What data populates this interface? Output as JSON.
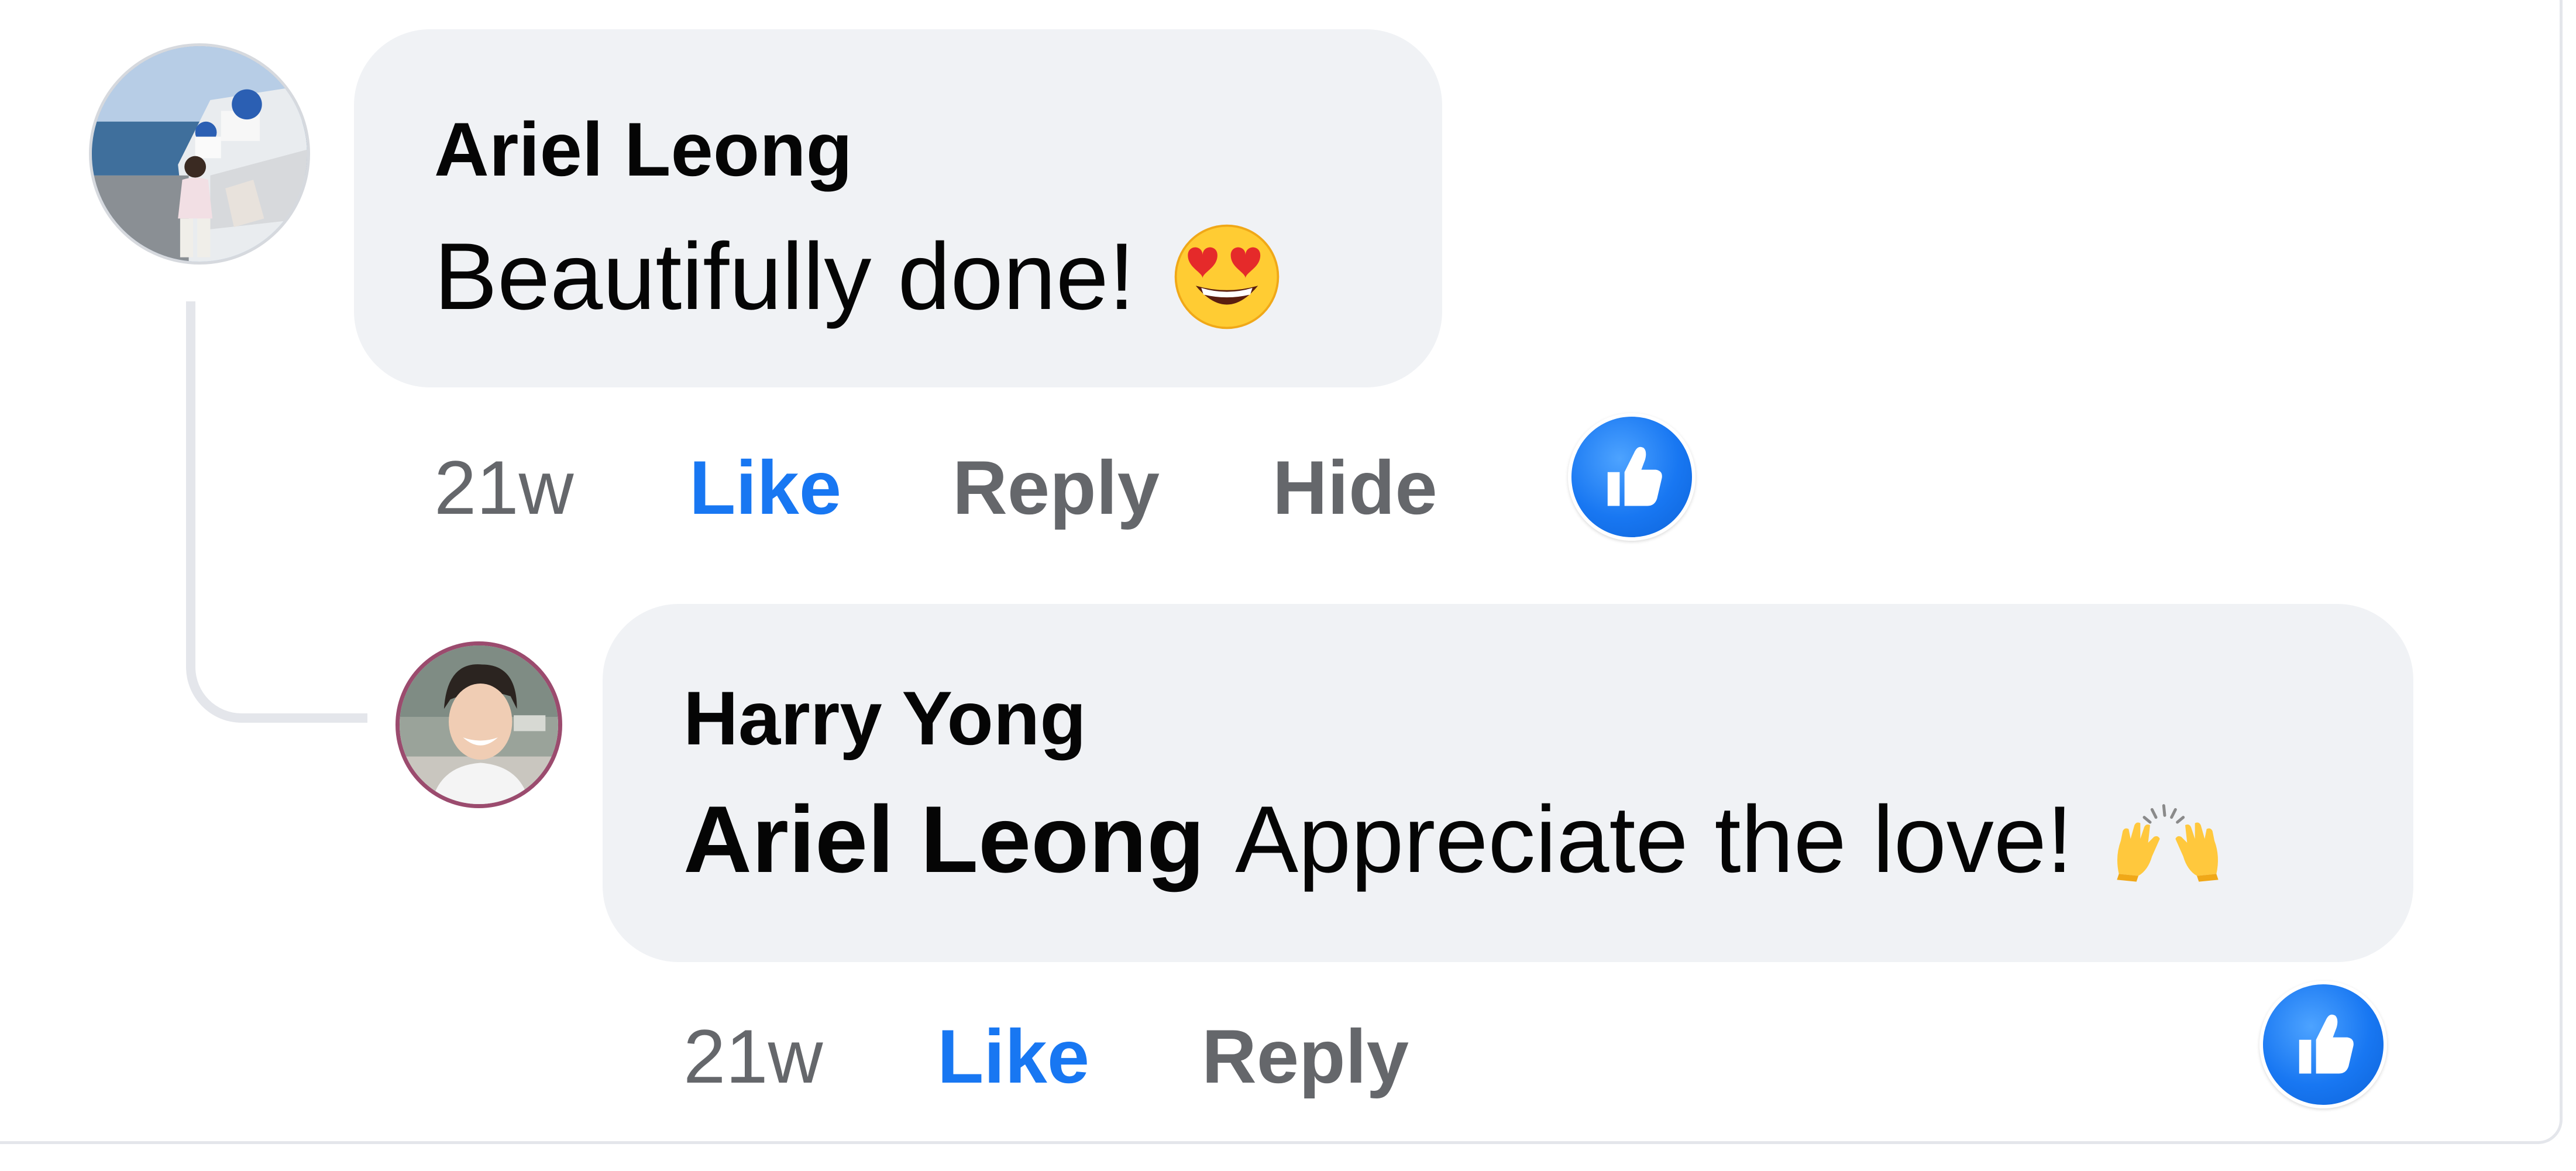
{
  "comments": [
    {
      "author": "Ariel Leong",
      "text": "Beautifully done!",
      "emoji": "smiling-face-with-heart-eyes",
      "timestamp": "21w",
      "actions": {
        "like": "Like",
        "reply": "Reply",
        "hide": "Hide"
      },
      "reaction": "like-icon"
    },
    {
      "author": "Harry Yong",
      "mention": "Ariel Leong",
      "text": "Appreciate the love!",
      "emoji": "raising-hands",
      "timestamp": "21w",
      "actions": {
        "like": "Like",
        "reply": "Reply"
      },
      "reaction": "like-icon"
    }
  ],
  "colors": {
    "bubble": "#f0f2f5",
    "like_active": "#1877f2",
    "meta_text": "#65676b",
    "primary_text": "#050505",
    "thread_line": "#e4e6eb"
  }
}
